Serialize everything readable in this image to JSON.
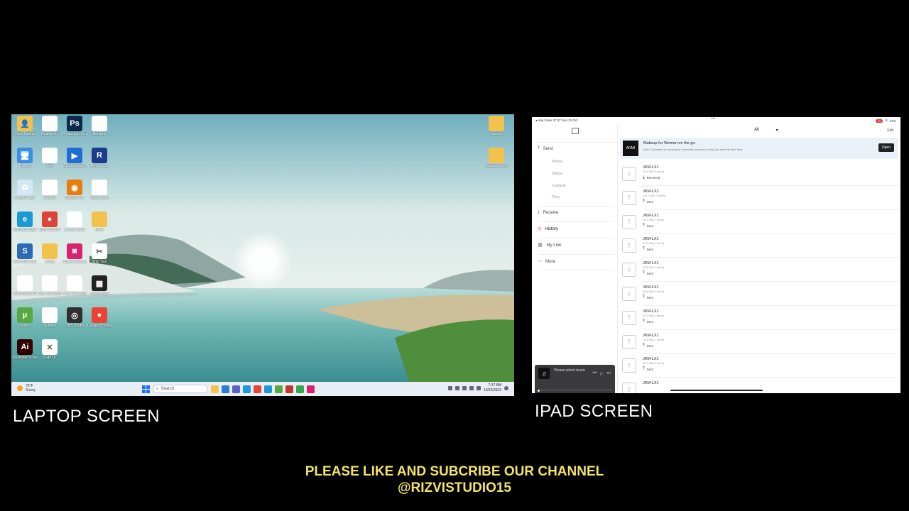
{
  "laptop": {
    "caption": "LAPTOP SCREEN",
    "desktop_icons": [
      {
        "label": "Rizvi Fatima",
        "color": "#f2c14e",
        "glyph": "👤"
      },
      {
        "label": "Notebooks",
        "color": "#ffffff",
        "glyph": ""
      },
      {
        "label": "Photoshop Screen",
        "color": "#0b2a4a",
        "glyph": "Ps"
      },
      {
        "label": "filename",
        "color": "#ffffff",
        "glyph": ""
      },
      {
        "label": "This PC",
        "color": "#3a8ee6",
        "glyph": "🖥"
      },
      {
        "label": "test",
        "color": "#ffffff",
        "glyph": ""
      },
      {
        "label": "Wondershare Filmora",
        "color": "#1f6fd1",
        "glyph": "▶"
      },
      {
        "label": "Revit 2023",
        "color": "#1d3c8a",
        "glyph": "R"
      },
      {
        "label": "Recycle Bin",
        "color": "#d5e7f5",
        "glyph": "♻"
      },
      {
        "label": "acrobat",
        "color": "#ffffff",
        "glyph": ""
      },
      {
        "label": "Blender 3.6",
        "color": "#e87d0d",
        "glyph": "◉"
      },
      {
        "label": "uploads file",
        "color": "#ffffff",
        "glyph": ""
      },
      {
        "label": "Microsoft Edge",
        "color": "#1b9ad6",
        "glyph": "e"
      },
      {
        "label": "Rizvi Chrome",
        "color": "#db4437",
        "glyph": "●"
      },
      {
        "label": "Lumion 2023",
        "color": "#ffffff",
        "glyph": ""
      },
      {
        "label": "Drive",
        "color": "#f2c14e",
        "glyph": ""
      },
      {
        "label": "SketchUp 2023",
        "color": "#2c6bb3",
        "glyph": "S"
      },
      {
        "label": "setup",
        "color": "#f2c14e",
        "glyph": ""
      },
      {
        "label": "Screen Recorder",
        "color": "#d6246e",
        "glyph": "◙"
      },
      {
        "label": "Snip Tool",
        "color": "#ffffff",
        "glyph": "✂"
      },
      {
        "label": "Screenshot 2023",
        "color": "#ffffff",
        "glyph": ""
      },
      {
        "label": "New Text Document",
        "color": "#ffffff",
        "glyph": ""
      },
      {
        "label": "New Text Document (2)",
        "color": "#ffffff",
        "glyph": ""
      },
      {
        "label": "Video 2023",
        "color": "#222222",
        "glyph": "▦"
      },
      {
        "label": "uTorrent",
        "color": "#58a942",
        "glyph": "µ"
      },
      {
        "label": "Untitled",
        "color": "#ffffff",
        "glyph": ""
      },
      {
        "label": "OBS Studio",
        "color": "#302e31",
        "glyph": "◎"
      },
      {
        "label": "Google Chrome",
        "color": "#ea4335",
        "glyph": "●"
      },
      {
        "label": "Illustrator Screen",
        "color": "#330000",
        "glyph": "Ai"
      },
      {
        "label": "CapCut",
        "color": "#ffffff",
        "glyph": "✕"
      }
    ],
    "right_icons": [
      {
        "label": "tutorial",
        "color": "#f2c14e"
      },
      {
        "label": "Autodesk Revit",
        "color": "#f2c14e"
      }
    ],
    "taskbar": {
      "weather_temp": "75°F",
      "weather_desc": "Sunny",
      "search_placeholder": "Search",
      "time": "7:37 AM",
      "date": "10/22/2023",
      "apps": [
        {
          "name": "file-explorer",
          "color": "#f2c14e"
        },
        {
          "name": "store",
          "color": "#2b7cd3"
        },
        {
          "name": "teams",
          "color": "#5b5fc7"
        },
        {
          "name": "lumion",
          "color": "#1a9ae0"
        },
        {
          "name": "chrome",
          "color": "#ea4335"
        },
        {
          "name": "edge",
          "color": "#1b9ad6"
        },
        {
          "name": "utorrent",
          "color": "#58a942"
        },
        {
          "name": "recorder",
          "color": "#c0392b"
        },
        {
          "name": "chrome-2",
          "color": "#34a853"
        },
        {
          "name": "screen-app",
          "color": "#d6246e"
        }
      ]
    }
  },
  "ipad": {
    "caption": "IPAD SCREEN",
    "status": {
      "left": "◂ App Store  07:37  Sun 22 Oct",
      "dots": "•••",
      "battery_badge": "10",
      "battery": "63%"
    },
    "sidebar": {
      "send": "Send",
      "sub": [
        "Photos",
        "Videos",
        "Contacts",
        "Files"
      ],
      "receive": "Receive",
      "history": "History",
      "my_link": "My Link",
      "more": "More"
    },
    "filter": {
      "label": "All",
      "chevron": "▾"
    },
    "edit": "Edit",
    "ad": {
      "logo": "ARMI",
      "title": "Makeup for Women on the go.",
      "desc": "Armi Cosmetics is working for incredible women so they can and feel their best.",
      "button": "Open"
    },
    "rows": [
      {
        "name": "JKM-LX1",
        "size": "15.3 MB (3 Items)",
        "status": "Received",
        "arrow": "⤓"
      },
      {
        "name": "JKM-LX1",
        "size": "140.7 MB (2 Items)",
        "status": "Sent",
        "arrow": "⤒"
      },
      {
        "name": "JKM-LX1",
        "size": "29.7 MB (1 Items)",
        "status": "Sent",
        "arrow": "⤒"
      },
      {
        "name": "JKM-LX1",
        "size": "84.8 MB (1 Items)",
        "status": "Sent",
        "arrow": "⤒"
      },
      {
        "name": "JKM-LX1",
        "size": "32.8 MB (1 Items)",
        "status": "Sent",
        "arrow": "⤒"
      },
      {
        "name": "JKM-LX1",
        "size": "86.8 MB (1 Items)",
        "status": "Sent",
        "arrow": "⤒"
      },
      {
        "name": "JKM-LX1",
        "size": "63.3 MB (1 Items)",
        "status": "Sent",
        "arrow": "⤒"
      },
      {
        "name": "JKM-LX1",
        "size": "76.9 MB (1 Items)",
        "status": "Sent",
        "arrow": "⤒"
      },
      {
        "name": "JKM-LX1",
        "size": "55.4 MB (1 Items)",
        "status": "Sent",
        "arrow": "⤒"
      },
      {
        "name": "JKM-LX1",
        "size": "",
        "status": "",
        "arrow": ""
      }
    ],
    "music": {
      "title": "Please select music",
      "prev": "⏮",
      "play": "▷",
      "next": "⏭"
    }
  },
  "cta": {
    "line1": "PLEASE LIKE AND SUBCRIBE OUR CHANNEL",
    "line2": "@RIZVISTUDIO15"
  }
}
